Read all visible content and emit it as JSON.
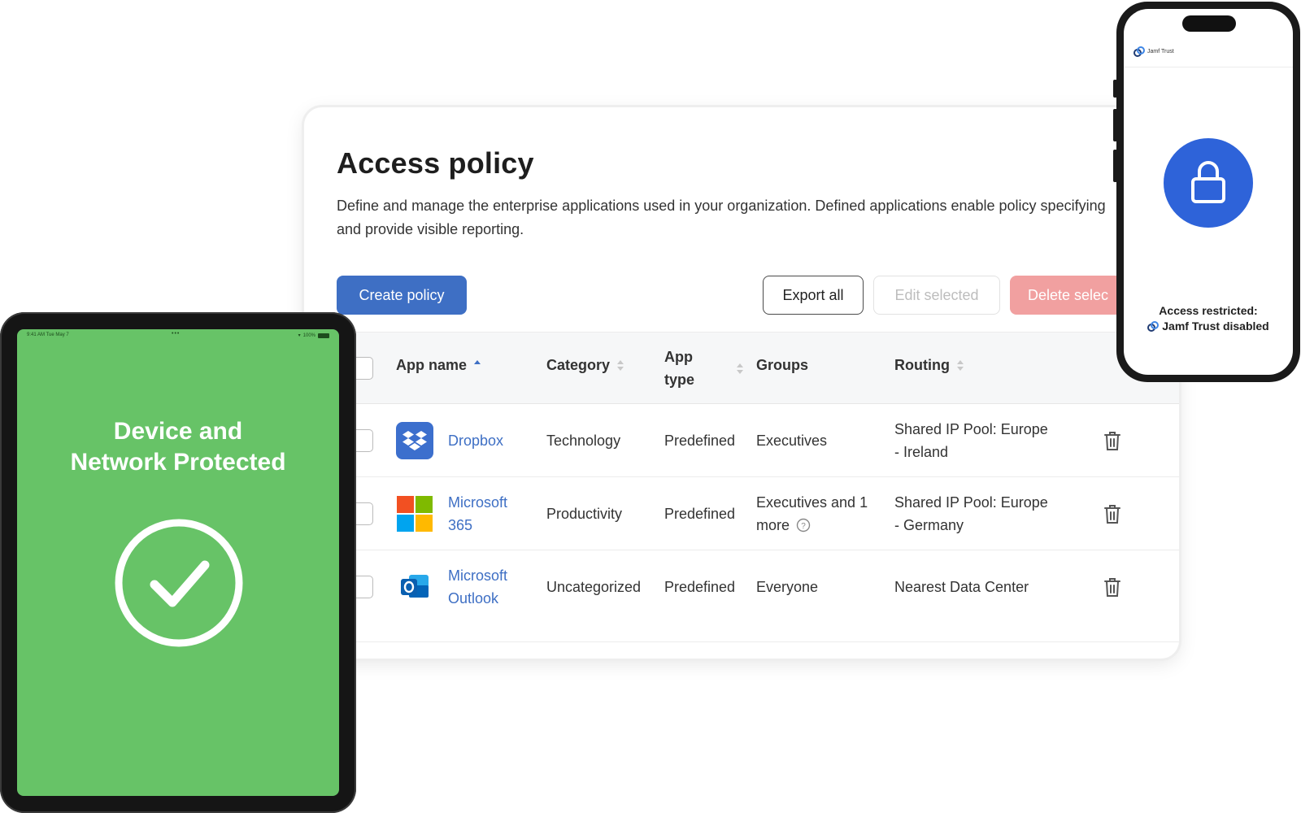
{
  "policy": {
    "title": "Access policy",
    "description": "Define and manage the enterprise applications used in your organization. Defined applications enable policy specifying and provide visible reporting.",
    "buttons": {
      "create": "Create policy",
      "export": "Export all",
      "edit": "Edit selected",
      "delete": "Delete selec"
    },
    "columns": {
      "app_name": "App name",
      "category": "Category",
      "app_type_1": "App",
      "app_type_2": "type",
      "groups": "Groups",
      "routing": "Routing"
    },
    "rows": [
      {
        "name_1": "Dropbox",
        "name_2": "",
        "category": "Technology",
        "type": "Predefined",
        "groups_1": "Executives",
        "groups_2": "",
        "routing_1": "Shared IP Pool: Europe",
        "routing_2": "- Ireland",
        "icon": "dropbox-icon"
      },
      {
        "name_1": "Microsoft",
        "name_2": "365",
        "category": "Productivity",
        "type": "Predefined",
        "groups_1": "Executives and 1",
        "groups_2": "more",
        "routing_1": "Shared IP Pool: Europe",
        "routing_2": "- Germany",
        "icon": "microsoft-365-icon"
      },
      {
        "name_1": "Microsoft",
        "name_2": "Outlook",
        "category": "Uncategorized",
        "type": "Predefined",
        "groups_1": "Everyone",
        "groups_2": "",
        "routing_1": "Nearest Data Center",
        "routing_2": "",
        "icon": "outlook-icon"
      }
    ]
  },
  "tablet": {
    "status_time": "9:41 AM   Tue May 7",
    "status_battery": "100%",
    "title_line1": "Device and",
    "title_line2": "Network Protected",
    "background": "#67c367"
  },
  "phone": {
    "brand": "Jamf Trust",
    "message_line1": "Access restricted:",
    "message_line2": "Jamf Trust disabled",
    "accent": "#2e63d9"
  },
  "colors": {
    "primary": "#3e6fc4",
    "danger_disabled": "#f1a0a0"
  }
}
